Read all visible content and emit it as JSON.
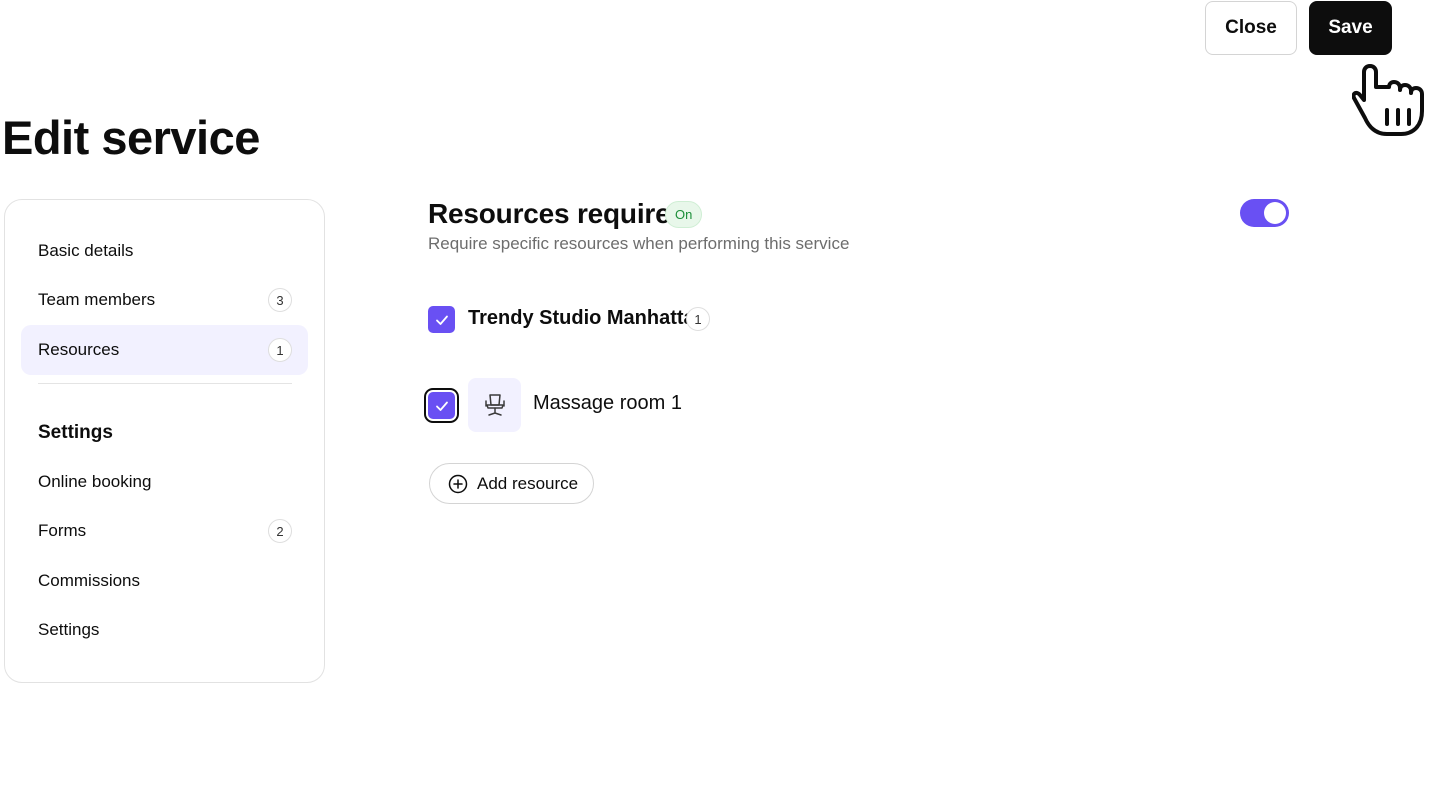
{
  "header": {
    "close_label": "Close",
    "save_label": "Save"
  },
  "page_title": "Edit service",
  "sidebar": {
    "items": [
      {
        "label": "Basic details",
        "count": null,
        "active": false
      },
      {
        "label": "Team members",
        "count": "3",
        "active": false
      },
      {
        "label": "Resources",
        "count": "1",
        "active": true
      }
    ],
    "settings_heading": "Settings",
    "settings_items": [
      {
        "label": "Online booking",
        "count": null
      },
      {
        "label": "Forms",
        "count": "2"
      },
      {
        "label": "Commissions",
        "count": null
      },
      {
        "label": "Settings",
        "count": null
      }
    ]
  },
  "resources": {
    "title": "Resources required",
    "status": "On",
    "subtitle": "Require specific resources when performing this service",
    "toggle_on": true,
    "location": {
      "name": "Trendy Studio Manhattan",
      "count": "1",
      "checked": true
    },
    "items": [
      {
        "name": "Massage room 1",
        "icon": "chair-icon",
        "checked": true
      }
    ],
    "add_label": "Add resource"
  },
  "colors": {
    "accent": "#6950f3",
    "accent_light": "#f2f1ff",
    "status_green": "#1d8f3a",
    "dark": "#0d0d0d"
  }
}
